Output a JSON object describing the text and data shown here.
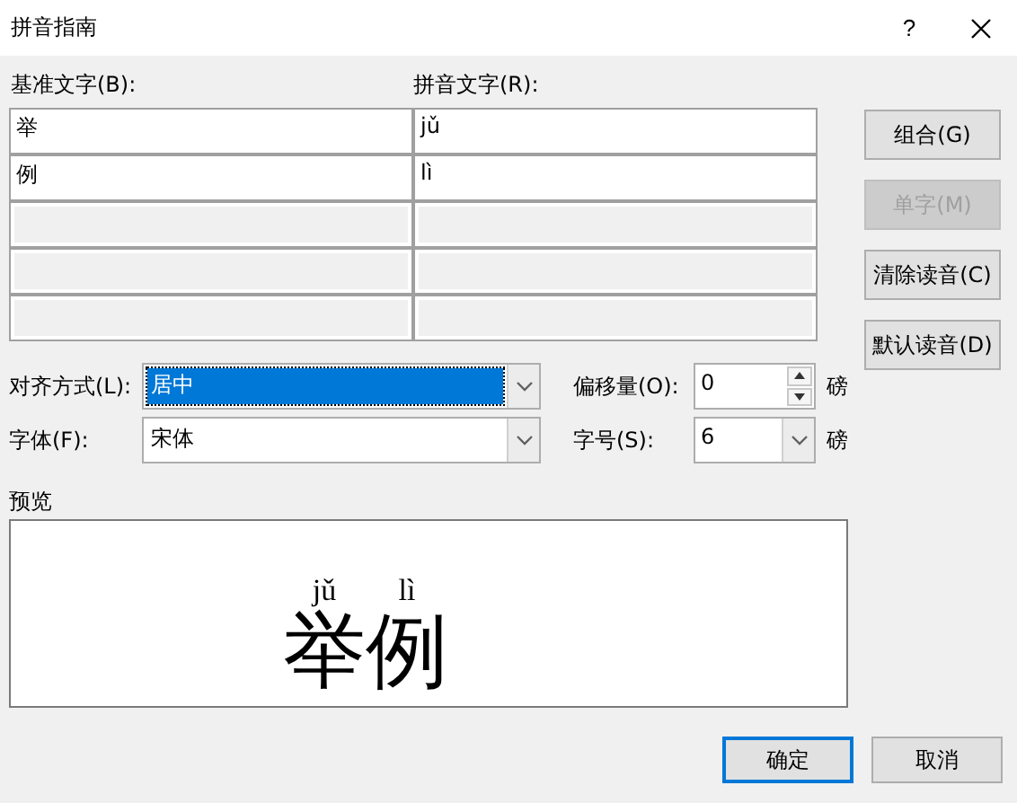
{
  "window": {
    "title": "拼音指南",
    "help": "?"
  },
  "base_label": "基准文字(B):",
  "ruby_label": "拼音文字(R):",
  "rows": [
    {
      "base": "举",
      "ruby": "jǔ"
    },
    {
      "base": "例",
      "ruby": "lì"
    }
  ],
  "buttons": [
    {
      "label": "组合(G)",
      "disabled": false
    },
    {
      "label": "单字(M)",
      "disabled": true
    },
    {
      "label": "清除读音(C)",
      "disabled": false
    },
    {
      "label": "默认读音(D)",
      "disabled": false
    }
  ],
  "alignment": {
    "label": "对齐方式(L):",
    "value": "居中",
    "focused": true
  },
  "offset": {
    "label": "偏移量(O):",
    "value": "0",
    "unit": "磅"
  },
  "font": {
    "label": "字体(F):",
    "value": "宋体"
  },
  "size": {
    "label": "字号(S):",
    "value": "6",
    "unit": "磅"
  },
  "preview": {
    "label": "预览",
    "pairs": [
      {
        "base": "举",
        "ruby": "jǔ"
      },
      {
        "base": "例",
        "ruby": "lì"
      }
    ]
  },
  "footer": [
    {
      "label": "确定",
      "default": true
    },
    {
      "label": "取消",
      "default": false
    }
  ]
}
